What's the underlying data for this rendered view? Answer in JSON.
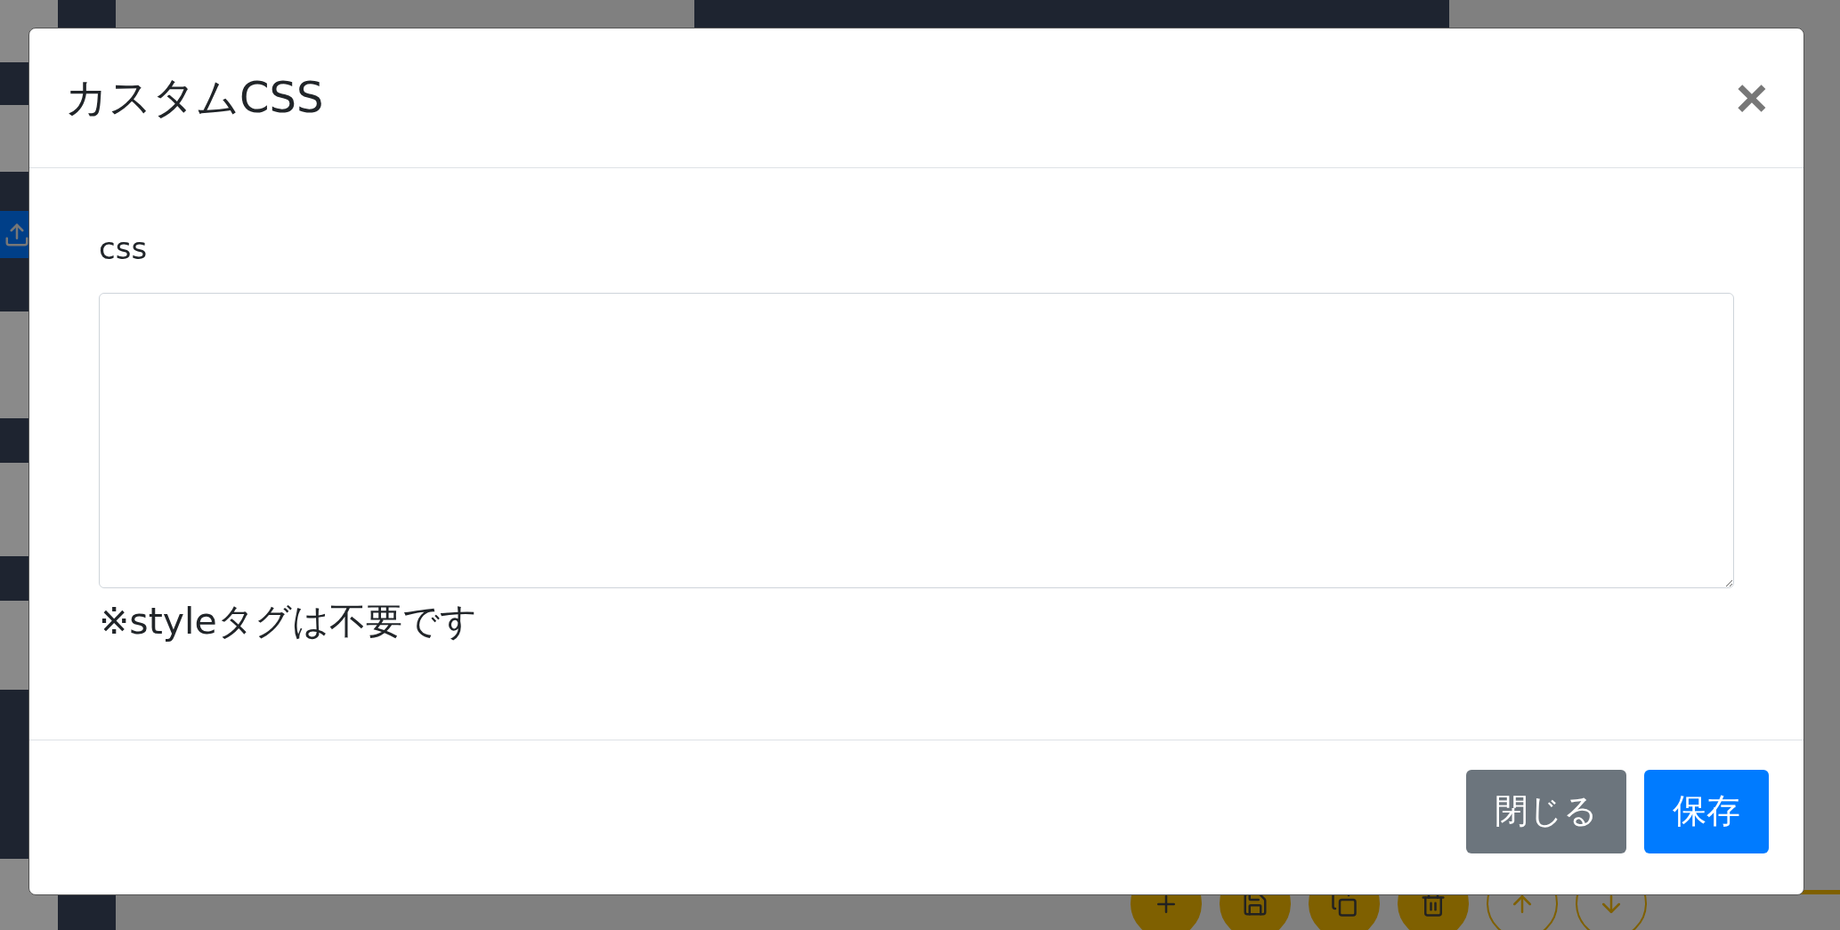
{
  "toolbar": [
    {
      "kind": "add",
      "disabled": false
    },
    {
      "kind": "save",
      "disabled": false
    },
    {
      "kind": "copy",
      "disabled": false
    },
    {
      "kind": "delete",
      "disabled": false
    },
    {
      "kind": "up",
      "disabled": true
    },
    {
      "kind": "down",
      "disabled": true
    }
  ],
  "modal": {
    "title": "カスタムCSS",
    "close": "×",
    "field": {
      "label": "css"
    },
    "hint": "※styleタグは不要です",
    "buttons": [
      {
        "label": "閉じる",
        "kind": "secondary"
      },
      {
        "label": "保存",
        "kind": "primary"
      }
    ]
  }
}
